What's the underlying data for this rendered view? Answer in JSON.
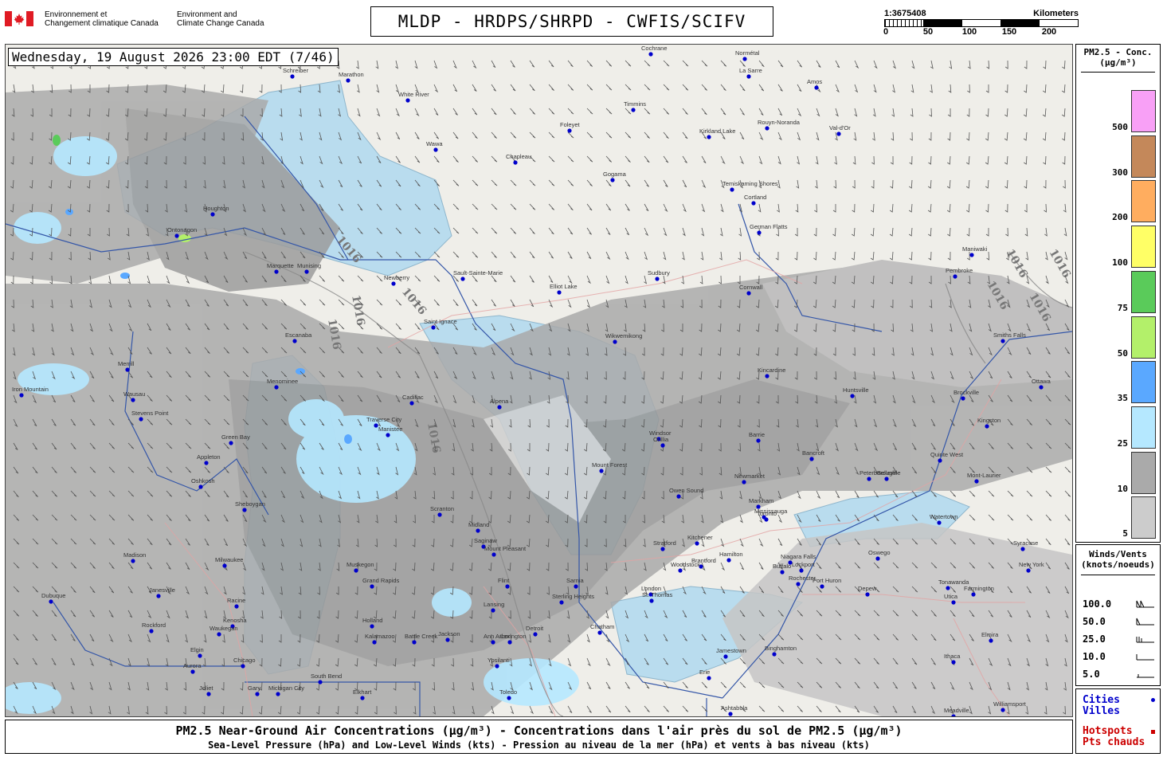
{
  "header": {
    "agency_fr": [
      "Environnement et",
      "Changement climatique Canada"
    ],
    "agency_en": [
      "Environment and",
      "Climate Change Canada"
    ],
    "title": "MLDP - HRDPS/SHRPD - CWFIS/SCIFV"
  },
  "scale": {
    "ratio": "1:3675408",
    "unit": "Kilometers",
    "ticks": [
      "0",
      "50",
      "100",
      "150",
      "200"
    ]
  },
  "map": {
    "timestamp": "Wednesday, 19 August 2026 23:00 EDT (7/46)",
    "cities": [
      "Schreiber",
      "Marathon",
      "White River",
      "Wawa",
      "Chapleau",
      "Foleyet",
      "Timmins",
      "Cochrane",
      "Normétal",
      "La Sarre",
      "Amos",
      "Val-d'Or",
      "Rouyn-Noranda",
      "Kirkland Lake",
      "Temiskaming Shores",
      "Gogama",
      "Sudbury",
      "Elliot Lake",
      "Sault-Sainte-Marie",
      "Newberry",
      "Saint Ignace",
      "Wikwemikong",
      "Houghton",
      "Ontonagon",
      "Marquette",
      "Munising",
      "Escanaba",
      "Menominee",
      "Green Bay",
      "Appleton",
      "Oshkosh",
      "Sheboygan",
      "Milwaukee",
      "Racine",
      "Kenosha",
      "Waukegan",
      "Chicago",
      "Gary",
      "Michigan City",
      "South Bend",
      "Elkhart",
      "Rockford",
      "Elgin",
      "Aurora",
      "Joliet",
      "Janesville",
      "Madison",
      "Dubuque",
      "Wausau",
      "Stevens Point",
      "Merrill",
      "Iron Mountain",
      "Manistee",
      "Cadillac",
      "Traverse City",
      "Alpena",
      "Midland",
      "Saginaw",
      "Flint",
      "Lansing",
      "Grand Rapids",
      "Muskegon",
      "Holland",
      "Kalamazoo",
      "Battle Creek",
      "Jackson",
      "Ann Arbor",
      "Detroit",
      "Ypsilanti",
      "Toledo",
      "Sarnia",
      "London",
      "St. Thomas",
      "Chatham",
      "Windsor",
      "Stratford",
      "Kitchener",
      "Woodstock",
      "Brantford",
      "Hamilton",
      "Mississauga",
      "Toronto",
      "Markham",
      "Newmarket",
      "Barrie",
      "Orillia",
      "Owen Sound",
      "Mount Forest",
      "Kincardine",
      "Huntsville",
      "Bancroft",
      "Peterborough",
      "Belleville",
      "Quinte West",
      "Kingston",
      "Brockville",
      "Smiths Falls",
      "Ottawa",
      "Cornwall",
      "Pembroke",
      "Maniwaki",
      "Mont-Laurier",
      "Watertown",
      "Oswego",
      "Rochester",
      "Buffalo",
      "Niagara Falls",
      "Lockport",
      "Tonawanda",
      "Syracuse",
      "Utica",
      "Ithaca",
      "Elmira",
      "Binghamton",
      "Jamestown",
      "Erie",
      "Ashtabula",
      "Meadville",
      "Williamsport",
      "Scranton",
      "Mount Pleasant",
      "Lexington",
      "Sterling Heights",
      "Port Huron",
      "Depew",
      "Farmington",
      "New York",
      "Cortland",
      "German Flatts"
    ],
    "isobar_labels": [
      "1016",
      "1016",
      "1016",
      "1016",
      "1016",
      "1016",
      "1016",
      "1016",
      "1016"
    ]
  },
  "pm25_legend": {
    "title": [
      "PM2.5 - Conc.",
      "(µg/m³)"
    ],
    "colors": [
      "#f8a0f6",
      "#c4885a",
      "#ffad5f",
      "#ffff66",
      "#5acb5a",
      "#b3f06a",
      "#5aa8ff",
      "#b5e8ff",
      "#aaaaaa",
      "#cccccc"
    ],
    "labels": [
      "500",
      "300",
      "200",
      "100",
      "75",
      "50",
      "35",
      "25",
      "10",
      "5"
    ]
  },
  "wind_legend": {
    "title": [
      "Winds/Vents",
      "(knots/noeuds)"
    ],
    "values": [
      "100.0",
      "50.0",
      "25.0",
      "10.0",
      "5.0"
    ]
  },
  "point_legend": {
    "cities": [
      "Cities",
      "Villes"
    ],
    "hotspots": [
      "Hotspots",
      "Pts chauds"
    ],
    "cities_color": "#0000cc",
    "hotspots_color": "#cc0000"
  },
  "footer": {
    "line1": "PM2.5 Near-Ground Air Concentrations (µg/m³) - Concentrations dans l'air près du sol de PM2.5 (µg/m³)",
    "line2": "Sea-Level Pressure (hPa) and Low-Level Winds (kts) - Pression au niveau de la mer (hPa) et vents à bas niveau (kts)"
  }
}
